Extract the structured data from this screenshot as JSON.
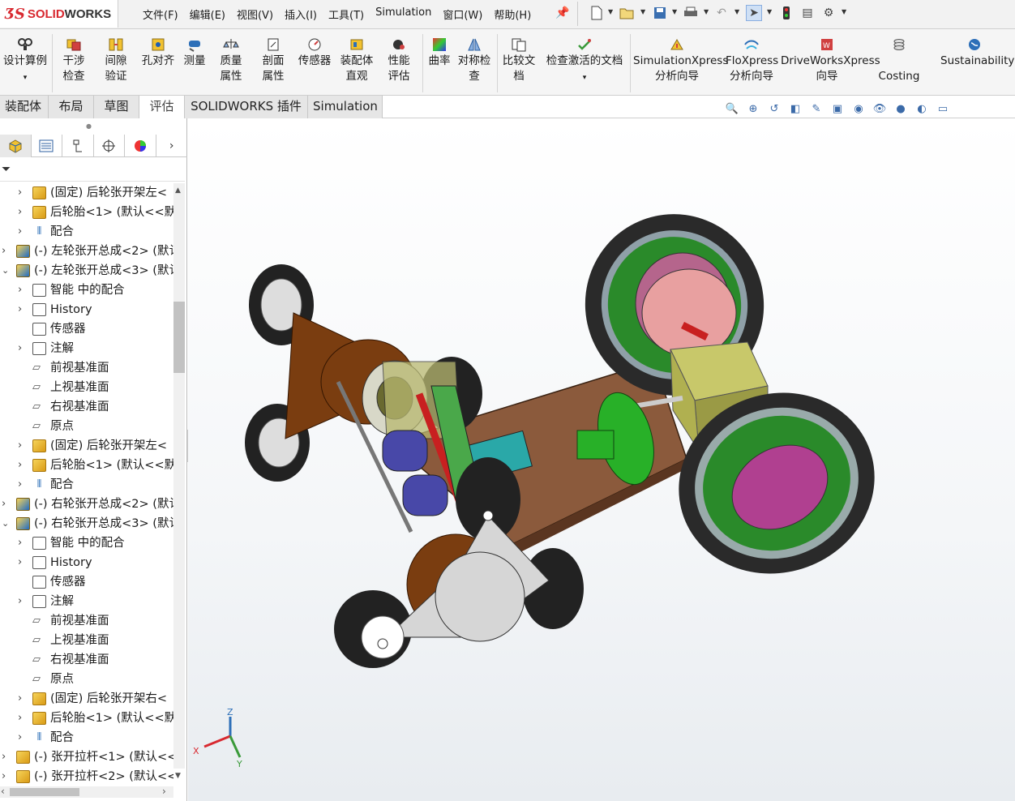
{
  "app": {
    "brand_prefix": "SOLID",
    "brand_suffix": "WORKS"
  },
  "menu": [
    "文件(F)",
    "编辑(E)",
    "视图(V)",
    "插入(I)",
    "工具(T)",
    "Simulation",
    "窗口(W)",
    "帮助(H)"
  ],
  "ribbon": {
    "items": [
      {
        "label": "设计算例",
        "icon": "design-study-icon"
      },
      {
        "label": "干涉检查",
        "icon": "interference-icon"
      },
      {
        "label": "间隙验证",
        "icon": "clearance-icon"
      },
      {
        "label": "孔对齐",
        "icon": "hole-align-icon"
      },
      {
        "label": "测量",
        "icon": "measure-icon"
      },
      {
        "label": "质量属性",
        "icon": "mass-properties-icon"
      },
      {
        "label": "剖面属性",
        "icon": "section-properties-icon"
      },
      {
        "label": "传感器",
        "icon": "sensor-icon"
      },
      {
        "label": "装配体直观",
        "icon": "assembly-visualization-icon"
      },
      {
        "label": "性能评估",
        "icon": "performance-icon"
      },
      {
        "label": "曲率",
        "icon": "curvature-icon"
      },
      {
        "label": "对称检查",
        "icon": "symmetry-icon"
      },
      {
        "label": "比较文档",
        "icon": "compare-icon"
      },
      {
        "label": "检查激活的文档",
        "icon": "check-document-icon"
      },
      {
        "label": "SimulationXpress分析向导",
        "icon": "simulationxpress-icon"
      },
      {
        "label": "FloXpress分析向导",
        "icon": "floxpress-icon"
      },
      {
        "label": "DriveWorksXpress向导",
        "icon": "driveworks-icon"
      },
      {
        "label": "Costing",
        "icon": "costing-icon"
      },
      {
        "label": "Sustainability",
        "icon": "sustainability-icon"
      }
    ]
  },
  "tabs": [
    {
      "label": "装配体",
      "active": false
    },
    {
      "label": "布局",
      "active": false
    },
    {
      "label": "草图",
      "active": false
    },
    {
      "label": "评估",
      "active": true
    },
    {
      "label": "SOLIDWORKS 插件",
      "active": false
    },
    {
      "label": "Simulation",
      "active": false
    }
  ],
  "tree": [
    {
      "label": "(固定) 后轮张开架左<",
      "type": "part",
      "indent": 1
    },
    {
      "label": "后轮胎<1> (默认<<默",
      "type": "part",
      "indent": 1
    },
    {
      "label": "配合",
      "type": "mate",
      "indent": 1
    },
    {
      "label": "(-) 左轮张开总成<2> (默认",
      "type": "asm",
      "indent": 0
    },
    {
      "label": "(-) 左轮张开总成<3> (默认",
      "type": "asm",
      "indent": 0,
      "expanded": true
    },
    {
      "label": "智能 中的配合",
      "type": "folder",
      "indent": 1
    },
    {
      "label": "History",
      "type": "folder",
      "indent": 1
    },
    {
      "label": "传感器",
      "type": "folder",
      "indent": 1,
      "noexp": true
    },
    {
      "label": "注解",
      "type": "folder",
      "indent": 1
    },
    {
      "label": "前视基准面",
      "type": "plane",
      "indent": 1,
      "noexp": true
    },
    {
      "label": "上视基准面",
      "type": "plane",
      "indent": 1,
      "noexp": true
    },
    {
      "label": "右视基准面",
      "type": "plane",
      "indent": 1,
      "noexp": true
    },
    {
      "label": "原点",
      "type": "plane",
      "indent": 1,
      "noexp": true
    },
    {
      "label": "(固定) 后轮张开架左<",
      "type": "part",
      "indent": 1
    },
    {
      "label": "后轮胎<1> (默认<<默",
      "type": "part",
      "indent": 1
    },
    {
      "label": "配合",
      "type": "mate",
      "indent": 1
    },
    {
      "label": "(-) 右轮张开总成<2> (默认",
      "type": "asm",
      "indent": 0
    },
    {
      "label": "(-) 右轮张开总成<3> (默认",
      "type": "asm",
      "indent": 0,
      "expanded": true
    },
    {
      "label": "智能 中的配合",
      "type": "folder",
      "indent": 1
    },
    {
      "label": "History",
      "type": "folder",
      "indent": 1
    },
    {
      "label": "传感器",
      "type": "folder",
      "indent": 1,
      "noexp": true
    },
    {
      "label": "注解",
      "type": "folder",
      "indent": 1
    },
    {
      "label": "前视基准面",
      "type": "plane",
      "indent": 1,
      "noexp": true
    },
    {
      "label": "上视基准面",
      "type": "plane",
      "indent": 1,
      "noexp": true
    },
    {
      "label": "右视基准面",
      "type": "plane",
      "indent": 1,
      "noexp": true
    },
    {
      "label": "原点",
      "type": "plane",
      "indent": 1,
      "noexp": true
    },
    {
      "label": "(固定) 后轮张开架右<",
      "type": "part",
      "indent": 1
    },
    {
      "label": "后轮胎<1> (默认<<默",
      "type": "part",
      "indent": 1
    },
    {
      "label": "配合",
      "type": "mate",
      "indent": 1
    },
    {
      "label": "(-) 张开拉杆<1> (默认<<",
      "type": "part",
      "indent": 0
    },
    {
      "label": "(-) 张开拉杆<2> (默认<<",
      "type": "part",
      "indent": 0
    }
  ],
  "triad": {
    "x": "X",
    "y": "Y",
    "z": "Z"
  },
  "colors": {
    "accent": "#d8282f",
    "tree_icon": "#f0c040",
    "selection": "#2d6fb8"
  }
}
